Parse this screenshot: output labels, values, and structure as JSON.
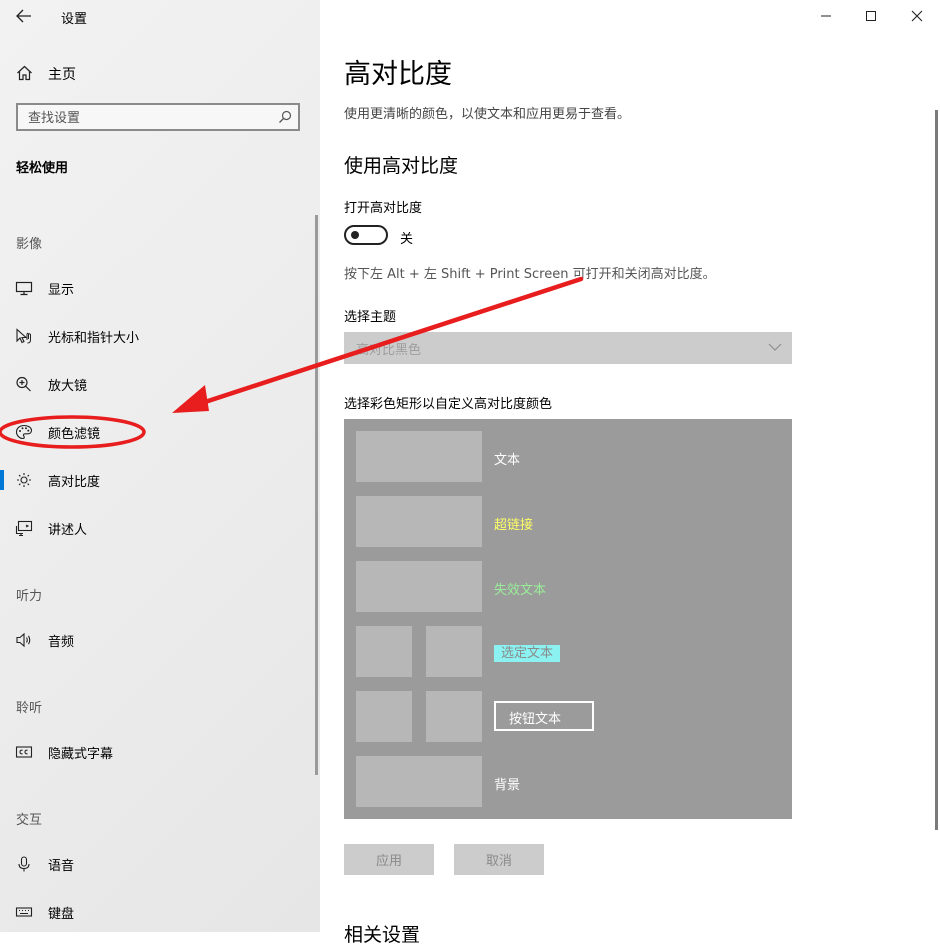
{
  "window": {
    "title": "设置",
    "controls": [
      "minimize",
      "maximize",
      "close"
    ]
  },
  "sidebar": {
    "home_label": "主页",
    "search_placeholder": "查找设置",
    "category_title": "轻松使用",
    "sections": {
      "vision": "影像",
      "hearing": "听力",
      "interaction": "交互",
      "listen": "聆听"
    },
    "items": {
      "display": "显示",
      "cursor": "光标和指针大小",
      "magnifier": "放大镜",
      "color_filters": "颜色滤镜",
      "high_contrast": "高对比度",
      "narrator": "讲述人",
      "audio": "音频",
      "captions": "隐藏式字幕",
      "speech": "语音",
      "keyboard": "键盘"
    },
    "active_item": "高对比度"
  },
  "main": {
    "title": "高对比度",
    "description": "使用更清晰的颜色，以使文本和应用更易于查看。",
    "section_title": "使用高对比度",
    "toggle_label": "打开高对比度",
    "toggle_state": "关",
    "shortcut_hint": "按下左 Alt + 左 Shift + Print Screen 可打开和关闭高对比度。",
    "theme_label": "选择主题",
    "theme_value": "高对比黑色",
    "colors_label": "选择彩色矩形以自定义高对比度颜色",
    "color_labels": {
      "text": "文本",
      "hyperlink": "超链接",
      "disabled_text": "失效文本",
      "selected_text": "选定文本",
      "button_text": "按钮文本",
      "background": "背景"
    },
    "apply_label": "应用",
    "cancel_label": "取消",
    "related_title": "相关设置"
  },
  "colors": {
    "accent": "#0078d7",
    "hyperlink": "#ffff66",
    "disabled_text": "#99ee99",
    "selected_bg": "#8cf1f1",
    "panel_bg": "#9b9b9b",
    "swatch": "#b7b7b7",
    "annotation": "#e81d1d"
  }
}
